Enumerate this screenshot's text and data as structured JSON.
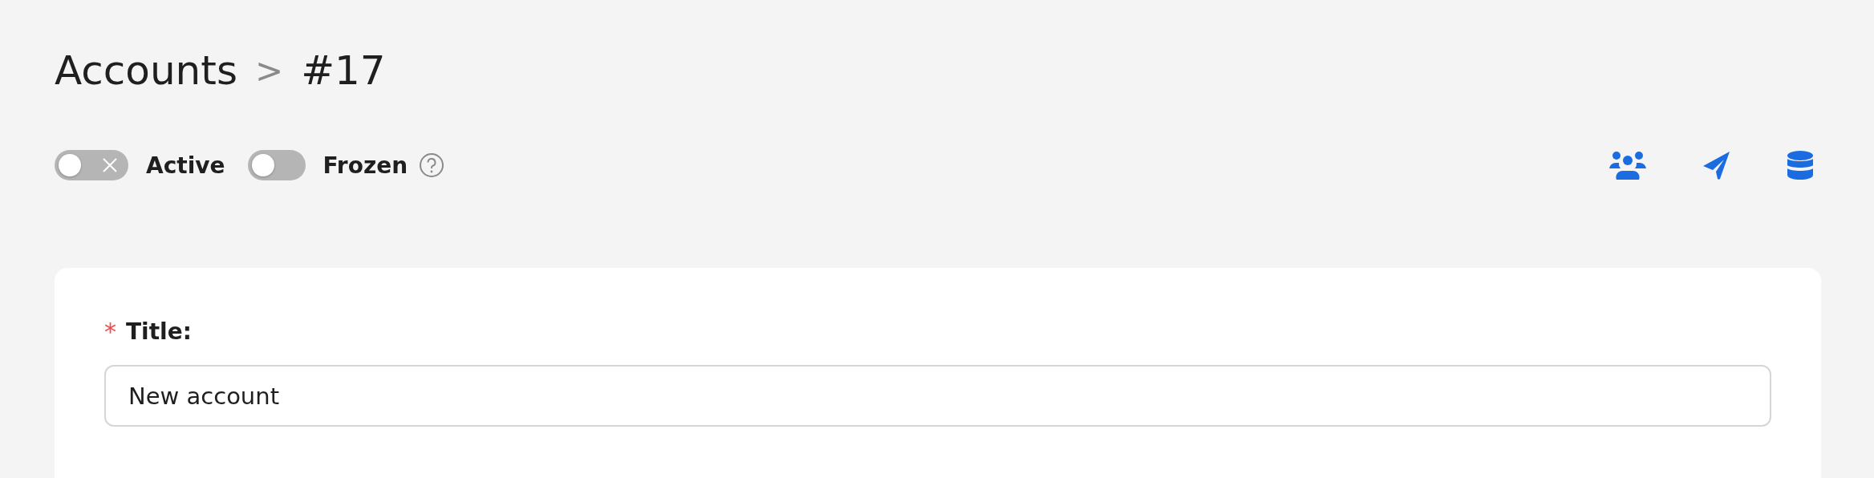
{
  "breadcrumb": [
    {
      "label": "Accounts",
      "kind": "link"
    },
    {
      "label": ">",
      "kind": "separator"
    },
    {
      "label": "#17",
      "kind": "current"
    }
  ],
  "toggles": [
    {
      "label": "Active",
      "on": false,
      "kind": "icon",
      "help": false
    },
    {
      "label": "Frozen",
      "on": false,
      "kind": "plain",
      "help": true
    }
  ],
  "actions": [
    {
      "kind": "users"
    },
    {
      "kind": "send"
    },
    {
      "kind": "database"
    }
  ],
  "form": {
    "fields": [
      {
        "label": "Title:",
        "required_mark": "*",
        "value": "New account"
      }
    ]
  }
}
